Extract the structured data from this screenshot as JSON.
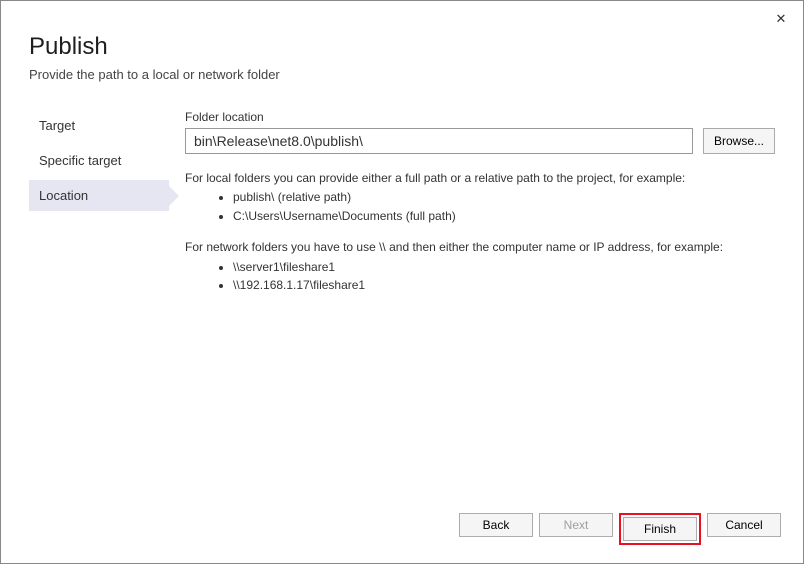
{
  "close_glyph": "✕",
  "header": {
    "title": "Publish",
    "subtitle": "Provide the path to a local or network folder"
  },
  "sidebar": {
    "items": [
      {
        "label": "Target"
      },
      {
        "label": "Specific target"
      },
      {
        "label": "Location"
      }
    ]
  },
  "main": {
    "folder_label": "Folder location",
    "folder_value": "bin\\Release\\net8.0\\publish\\",
    "browse_label": "Browse...",
    "help_local_intro": "For local folders you can provide either a full path or a relative path to the project, for example:",
    "help_local_ex1": "publish\\ (relative path)",
    "help_local_ex2": "C:\\Users\\Username\\Documents (full path)",
    "help_network_intro": "For network folders you have to use \\\\ and then either the computer name or IP address, for example:",
    "help_network_ex1": "\\\\server1\\fileshare1",
    "help_network_ex2": "\\\\192.168.1.17\\fileshare1"
  },
  "footer": {
    "back": "Back",
    "next": "Next",
    "finish": "Finish",
    "cancel": "Cancel"
  }
}
